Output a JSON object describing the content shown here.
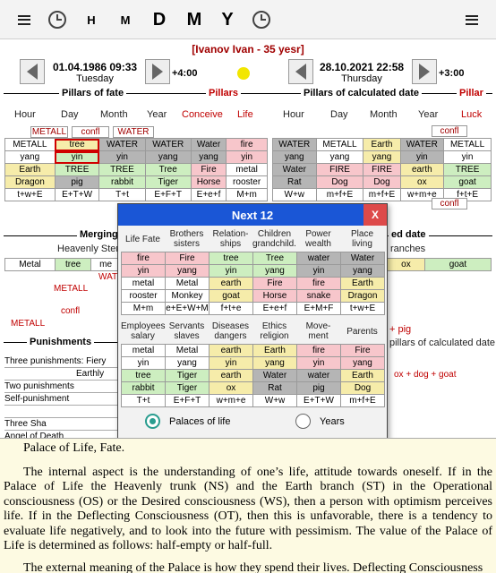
{
  "toolbar": {
    "h": "H",
    "m": "M",
    "d": "D",
    "mo": "M",
    "y": "Y"
  },
  "person": "[Ivanov Ivan - 35 yesr]",
  "birth": {
    "datetime": "01.04.1986 09:33",
    "weekday": "Tuesday",
    "tz": "+4:00"
  },
  "current": {
    "datetime": "28.10.2021 22:58",
    "weekday": "Thursday",
    "tz": "+3:00"
  },
  "headers": {
    "fate": "Pillars of fate",
    "pillars_left": "Pillars",
    "calc": "Pillars of calculated date",
    "pillar_right": "Pillar"
  },
  "left_cols": [
    "Hour",
    "Day",
    "Month",
    "Year",
    "Conceive",
    "Life"
  ],
  "right_cols": [
    "Hour",
    "Day",
    "Month",
    "Year",
    "Luck"
  ],
  "left_tags": [
    "METALL",
    "confl",
    "WATER"
  ],
  "right_tag_top": "confl",
  "right_tag_bottom": "confl",
  "left_rows": [
    [
      "METALL",
      "tree",
      "WATER",
      "WATER",
      "Water",
      "fire"
    ],
    [
      "yang",
      "yin",
      "yin",
      "yang",
      "yang",
      "yin"
    ],
    [
      "Earth",
      "TREE",
      "TREE",
      "Tree",
      "Fire",
      "metal"
    ],
    [
      "Dragon",
      "pig",
      "rabbit",
      "Tiger",
      "Horse",
      "rooster"
    ],
    [
      "t+w+E",
      "E+T+W",
      "T+t",
      "E+F+T",
      "E+e+f",
      "M+m"
    ]
  ],
  "right_rows": [
    [
      "WATER",
      "METALL",
      "Earth",
      "WATER",
      "METALL"
    ],
    [
      "yang",
      "yang",
      "yang",
      "yin",
      "yin"
    ],
    [
      "Water",
      "FIRE",
      "FIRE",
      "earth",
      "TREE"
    ],
    [
      "Rat",
      "Dog",
      "Dog",
      "ox",
      "goat"
    ],
    [
      "W+w",
      "m+f+E",
      "m+f+E",
      "w+m+e",
      "f+t+E"
    ]
  ],
  "merging": {
    "title": "Merging",
    "label": "Heavenly Ster",
    "cells": [
      "Metal",
      "tree",
      "me"
    ],
    "wat": "WAT",
    "metall": "METALL",
    "confl": "confl",
    "metall2": "METALL"
  },
  "merging_right": {
    "title": "ed date",
    "label": "ranches",
    "cells": [
      "ox",
      "goat"
    ],
    "pig": "+ pig",
    "calc": "pillars of calculated date",
    "formula": "ox + dog + goat"
  },
  "punishments": {
    "title": "Punishments",
    "items": [
      "Three punishments: Fiery",
      "Earthly",
      "Two punishments",
      "Self-punishment",
      "",
      "Three Sha",
      "Angel of Death"
    ]
  },
  "dialog": {
    "title": "Next 12",
    "close": "X",
    "top_headers": [
      "Life Fate",
      "Brothers sisters",
      "Relation-ships",
      "Children grandchild.",
      "Power wealth",
      "Place living"
    ],
    "top_rows": [
      [
        "fire",
        "Fire",
        "tree",
        "Tree",
        "water",
        "Water"
      ],
      [
        "yin",
        "yang",
        "yin",
        "yang",
        "yin",
        "yang"
      ],
      [
        "metal",
        "Metal",
        "earth",
        "Fire",
        "fire",
        "Earth"
      ],
      [
        "rooster",
        "Monkey",
        "goat",
        "Horse",
        "snake",
        "Dragon"
      ],
      [
        "M+m",
        "e+E+W+M",
        "f+t+e",
        "E+e+f",
        "E+M+F",
        "t+w+E"
      ]
    ],
    "bottom_headers": [
      "Employees salary",
      "Servants slaves",
      "Diseases dangers",
      "Ethics religion",
      "Move-ment",
      "Parents"
    ],
    "bottom_rows": [
      [
        "metal",
        "Metal",
        "earth",
        "Earth",
        "fire",
        "Fire"
      ],
      [
        "yin",
        "yang",
        "yin",
        "yang",
        "yin",
        "yang"
      ],
      [
        "tree",
        "Tiger",
        "earth",
        "Water",
        "water",
        "Earth"
      ],
      [
        "rabbit",
        "Tiger",
        "ox",
        "Rat",
        "pig",
        "Dog"
      ],
      [
        "T+t",
        "E+F+T",
        "w+m+e",
        "W+w",
        "E+T+W",
        "m+f+E"
      ]
    ],
    "radio_palaces": "Palaces of life",
    "radio_years": "Years"
  },
  "text": {
    "heading": "Palace of Life, Fate.",
    "p1": "The internal aspect is the understanding of one’s life, attitude towards oneself. If in the Palace of Life the Heavenly trunk (NS) and the Earth branch (ST) in the Operational consciousness (OS) or the Desired consciousness (WS), then a person with optimism perceives life. If in the Deflecting Consciousness (OT), then this is unfavorable, there is a tendency to evaluate life negatively, and to look into the future with pessimism. The value of the Palace of Life is determined as follows: half-empty or half-full.",
    "p2": "The external meaning of the Palace is how they spend their lives. Deflecting Consciousness"
  }
}
